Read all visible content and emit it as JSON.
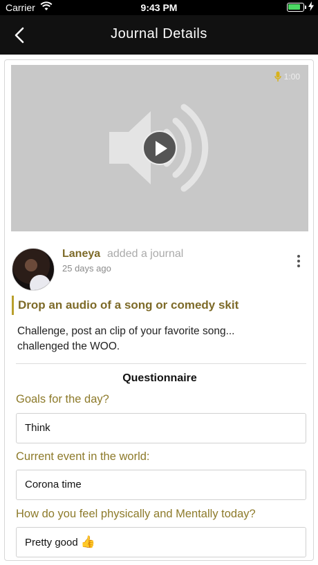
{
  "status_bar": {
    "carrier": "Carrier",
    "time": "9:43 PM"
  },
  "nav": {
    "title": "Journal Details"
  },
  "media": {
    "duration": "1:00"
  },
  "post": {
    "username": "Laneya",
    "action": "added a journal",
    "time_ago": "25 days ago",
    "prompt": "Drop an audio of a song or comedy skit",
    "description": "Challenge, post an clip of your favorite song... challenged the WOO."
  },
  "questionnaire": {
    "title": "Questionnaire",
    "questions": [
      {
        "label": "Goals for the day?",
        "answer": "Think"
      },
      {
        "label": "Current event in the world:",
        "answer": "Corona time"
      },
      {
        "label": "How do you feel physically and Mentally today?",
        "answer": "Pretty good",
        "emoji": "👍"
      }
    ]
  },
  "colors": {
    "accent": "#8d7a2a",
    "navbar": "#111111",
    "media_bg": "#c8c8c8"
  }
}
